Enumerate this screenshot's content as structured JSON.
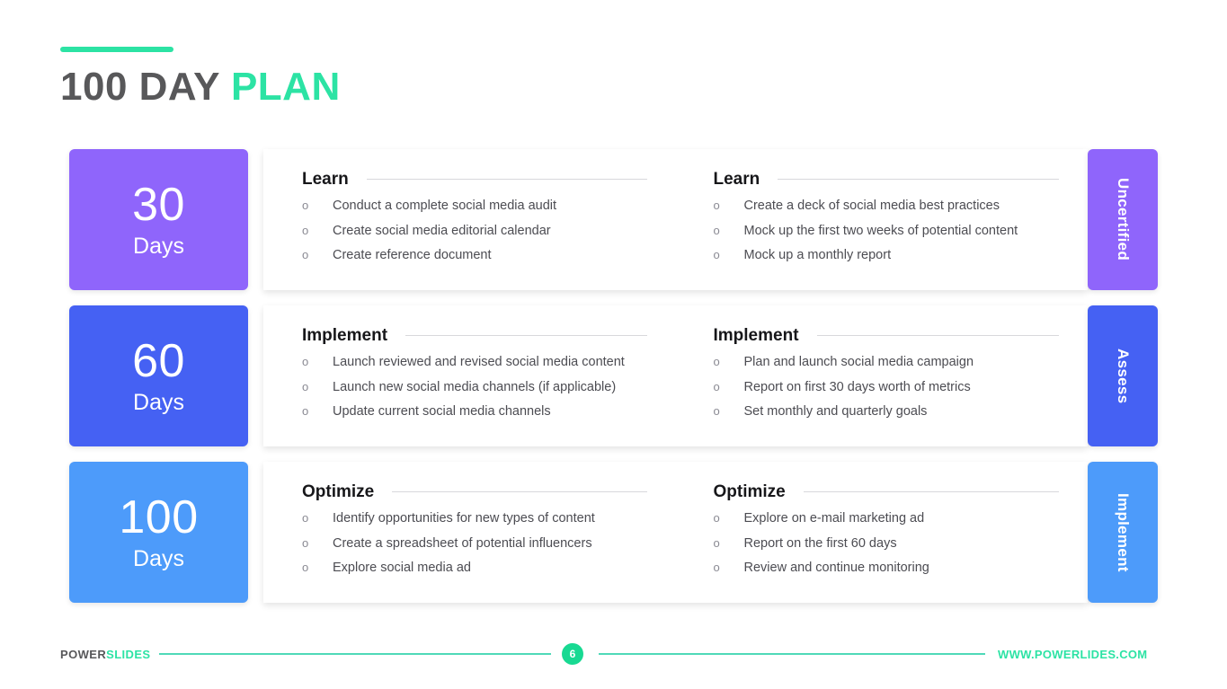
{
  "header": {
    "title_dark": "100 DAY",
    "title_accent": "PLAN",
    "accent_color": "#2CE3A4",
    "title_dark_color": "#58585A"
  },
  "rows": [
    {
      "day_number": "30",
      "day_unit": "Days",
      "block_color": "#8F65FB",
      "side_tab_label": "Uncertified",
      "columns": [
        {
          "title": "Learn",
          "items": [
            "Conduct a complete social media audit",
            "Create social media editorial calendar",
            "Create reference document"
          ]
        },
        {
          "title": "Learn",
          "items": [
            "Create a deck of social media best practices",
            "Mock up the first two weeks of potential content",
            "Mock up a monthly report"
          ]
        }
      ]
    },
    {
      "day_number": "60",
      "day_unit": "Days",
      "block_color": "#4561F3",
      "side_tab_label": "Assess",
      "columns": [
        {
          "title": "Implement",
          "items": [
            "Launch reviewed and revised social media content",
            "Launch new social media channels (if applicable)",
            "Update current social media channels"
          ]
        },
        {
          "title": "Implement",
          "items": [
            "Plan and launch social media campaign",
            "Report on first 30 days worth of metrics",
            "Set monthly and quarterly goals"
          ]
        }
      ]
    },
    {
      "day_number": "100",
      "day_unit": "Days",
      "block_color": "#4D9BFA",
      "side_tab_label": "Implement",
      "columns": [
        {
          "title": "Optimize",
          "items": [
            "Identify opportunities for new types of content",
            "Create a spreadsheet of potential influencers",
            "Explore social media ad"
          ]
        },
        {
          "title": "Optimize",
          "items": [
            "Explore on e-mail marketing ad",
            "Report on the first 60 days",
            "Review and continue monitoring"
          ]
        }
      ]
    }
  ],
  "bullet_marker": "o",
  "footer": {
    "brand_dark": "POWER",
    "brand_accent": "SLIDES",
    "page_number": "6",
    "url": "WWW.POWERLIDES.COM",
    "line_color": "#4FD9B8",
    "badge_color": "#18D992"
  }
}
